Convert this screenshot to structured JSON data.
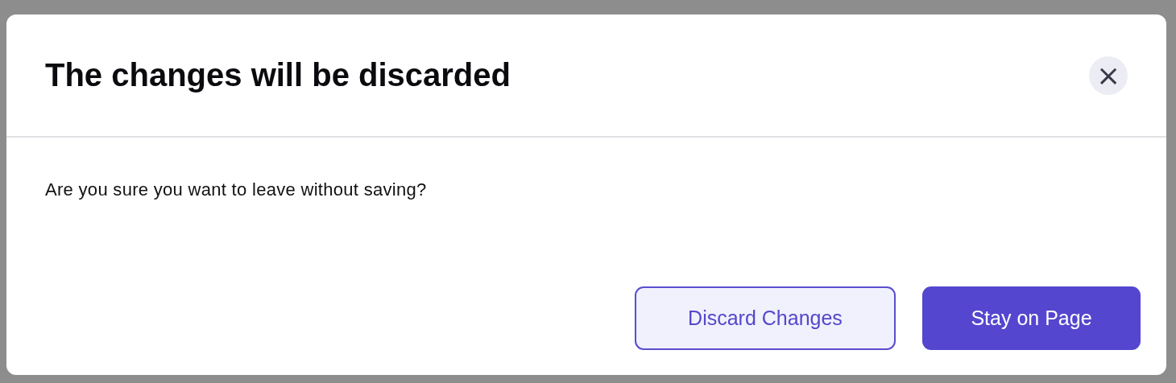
{
  "dialog": {
    "title": "The changes will be discarded",
    "close_button": "×",
    "message": "Are you sure you want to leave without saving?",
    "buttons": [
      {
        "label": "Discard Changes",
        "kind": "secondary"
      },
      {
        "label": "Stay on Page",
        "kind": "primary"
      }
    ]
  }
}
